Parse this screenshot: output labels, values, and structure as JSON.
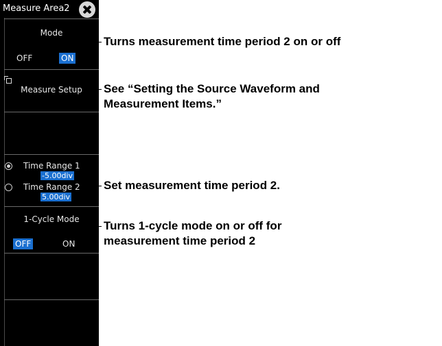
{
  "menu": {
    "title": "Measure Area2",
    "mode": {
      "label": "Mode",
      "off": "OFF",
      "on": "ON",
      "selected": "ON"
    },
    "measure_setup": {
      "label": "Measure Setup"
    },
    "time_range_1": {
      "label": "Time Range 1",
      "value": "-5.00div",
      "selected": true
    },
    "time_range_2": {
      "label": "Time Range 2",
      "value": "5.00div",
      "selected": false
    },
    "cycle_mode": {
      "label": "1-Cycle Mode",
      "off": "OFF",
      "on": "ON",
      "selected": "OFF"
    }
  },
  "callouts": {
    "mode": "Turns measurement time period 2 on or off",
    "setup_line1": "See “Setting the Source Waveform and",
    "setup_line2": "Measurement Items.”",
    "range": "Set measurement time period 2.",
    "cycle_line1": "Turns 1-cycle mode on or off for",
    "cycle_line2": "measurement time period 2"
  }
}
